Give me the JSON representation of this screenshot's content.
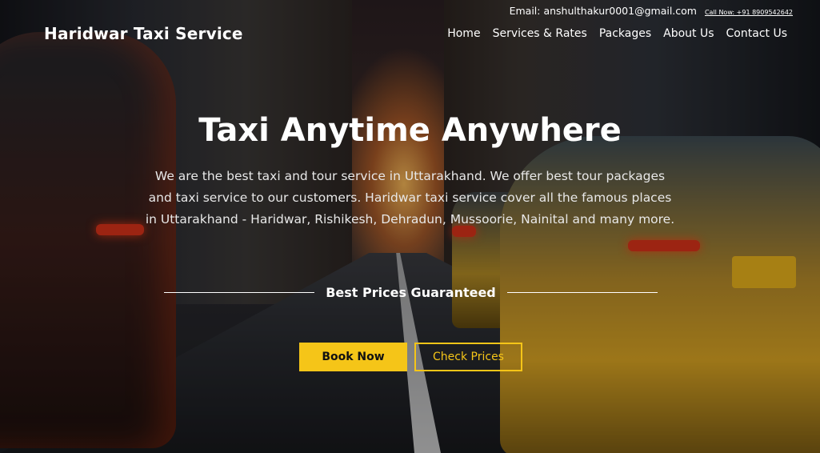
{
  "brand": {
    "name": "Haridwar Taxi Service"
  },
  "topbar": {
    "email": "Email: anshulthakur0001@gmail.com",
    "call": "Call Now: +91 8909542642"
  },
  "nav": {
    "items": [
      "Home",
      "Services & Rates",
      "Packages",
      "About Us",
      "Contact Us"
    ]
  },
  "hero": {
    "headline": "Taxi Anytime Anywhere",
    "description": "We are the best taxi and tour service in Uttarakhand. We offer best tour packages and taxi service to our customers. Haridwar taxi service cover all the famous places in Uttarakhand - Haridwar, Rishikesh, Dehradun, Mussoorie, Nainital and many more.",
    "tagline": "Best Prices Guaranteed",
    "primary_button": "Book Now",
    "secondary_button": "Check Prices"
  },
  "colors": {
    "accent": "#f5c518",
    "text": "#ffffff"
  }
}
